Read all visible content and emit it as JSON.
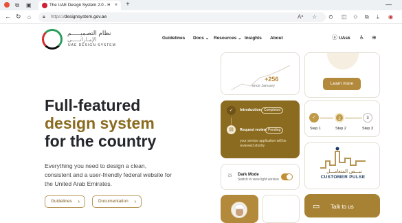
{
  "browser": {
    "tab_title": "The UAE Design System 2.0 - Hom",
    "tab_close": "×",
    "new_tab": "+",
    "url_prefix": "https://",
    "url_domain": "designsystem.gov.ae",
    "minimize": "—"
  },
  "header": {
    "logo_arabic": "نظام التصميـــــم",
    "logo_arabic2": "الإمـاراتـــــي",
    "logo_english": "UAE DESIGN SYSTEM",
    "nav": [
      "Guidelines",
      "Docs",
      "Resources",
      "Insights",
      "About"
    ],
    "uask_label": "UAsk"
  },
  "hero": {
    "line1": "Full-featured",
    "line2": "design system",
    "line3": "for the country",
    "description": "Everything you need to design a clean, consistent and a user-friendly federal website for the United Arab Emirates.",
    "btn_guidelines": "Guidelines",
    "btn_documentation": "Documentation"
  },
  "cards": {
    "stat_value": "+256",
    "stat_caption": "since January",
    "learn_more": "Learn more",
    "timeline": {
      "item1_title": "Introduction",
      "item1_status": "Completed",
      "item2_title": "Request review",
      "item2_status": "Pending",
      "item2_desc": "your service application will be reviewed shortly"
    },
    "stepper": {
      "step2_number": "2",
      "step3_number": "3",
      "labels": [
        "Step 1",
        "Step 2",
        "Step 3"
      ]
    },
    "customer_pulse_ar": "نبـــض المتعامـــل",
    "customer_pulse_en": "CUSTOMER PULSE",
    "dark_mode_title": "Dark Mode",
    "dark_mode_sub": "Switch to view light version",
    "talk_to_us": "Talk to us"
  },
  "colors": {
    "gold": "#8a6b1f",
    "gold_light": "#b38a3c",
    "dark_text": "#23262b"
  },
  "icons": {
    "back": "arrow-left-icon",
    "refresh": "refresh-icon",
    "lock": "lock-icon",
    "favorites": "star-icon",
    "chat": "chat-bubble-icon",
    "globe": "globe-icon",
    "accessibility": "accessibility-icon"
  }
}
